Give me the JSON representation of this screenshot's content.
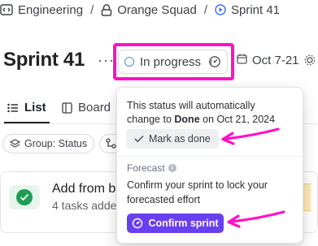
{
  "breadcrumb": {
    "items": [
      {
        "label": "Engineering",
        "icon": "code-folder-icon"
      },
      {
        "label": "Orange Squad",
        "icon": "lock-folder-icon"
      },
      {
        "label": "Sprint 41",
        "icon": "sprint-icon"
      }
    ],
    "separator": "/"
  },
  "header": {
    "title": "Sprint 41",
    "more": "···",
    "status": "In progress",
    "dates": "Oct 7-21"
  },
  "tabs": [
    {
      "label": "List",
      "icon": "list-icon",
      "active": true
    },
    {
      "label": "Board",
      "icon": "board-icon",
      "active": false
    }
  ],
  "filters": {
    "group": "Group: Status"
  },
  "card": {
    "title": "Add from ba",
    "subtitle": "4 tasks adde"
  },
  "popover": {
    "status_text_line1": "This status will automatically",
    "status_text_pre": "change to ",
    "status_text_bold": "Done",
    "status_text_post": " on Oct 21, 2024",
    "mark_done_label": "Mark as done",
    "forecast_label": "Forecast",
    "forecast_info": "i",
    "forecast_text_line1": "Confirm your sprint to lock your",
    "forecast_text_line2": "forecasted effort",
    "confirm_label": "Confirm sprint"
  },
  "colors": {
    "highlight": "#ff10c8",
    "arrow": "#ff10c8",
    "confirm_button": "#6a3ff0",
    "status_circle": "#4a90e2",
    "done_check": "#1f9d55"
  }
}
